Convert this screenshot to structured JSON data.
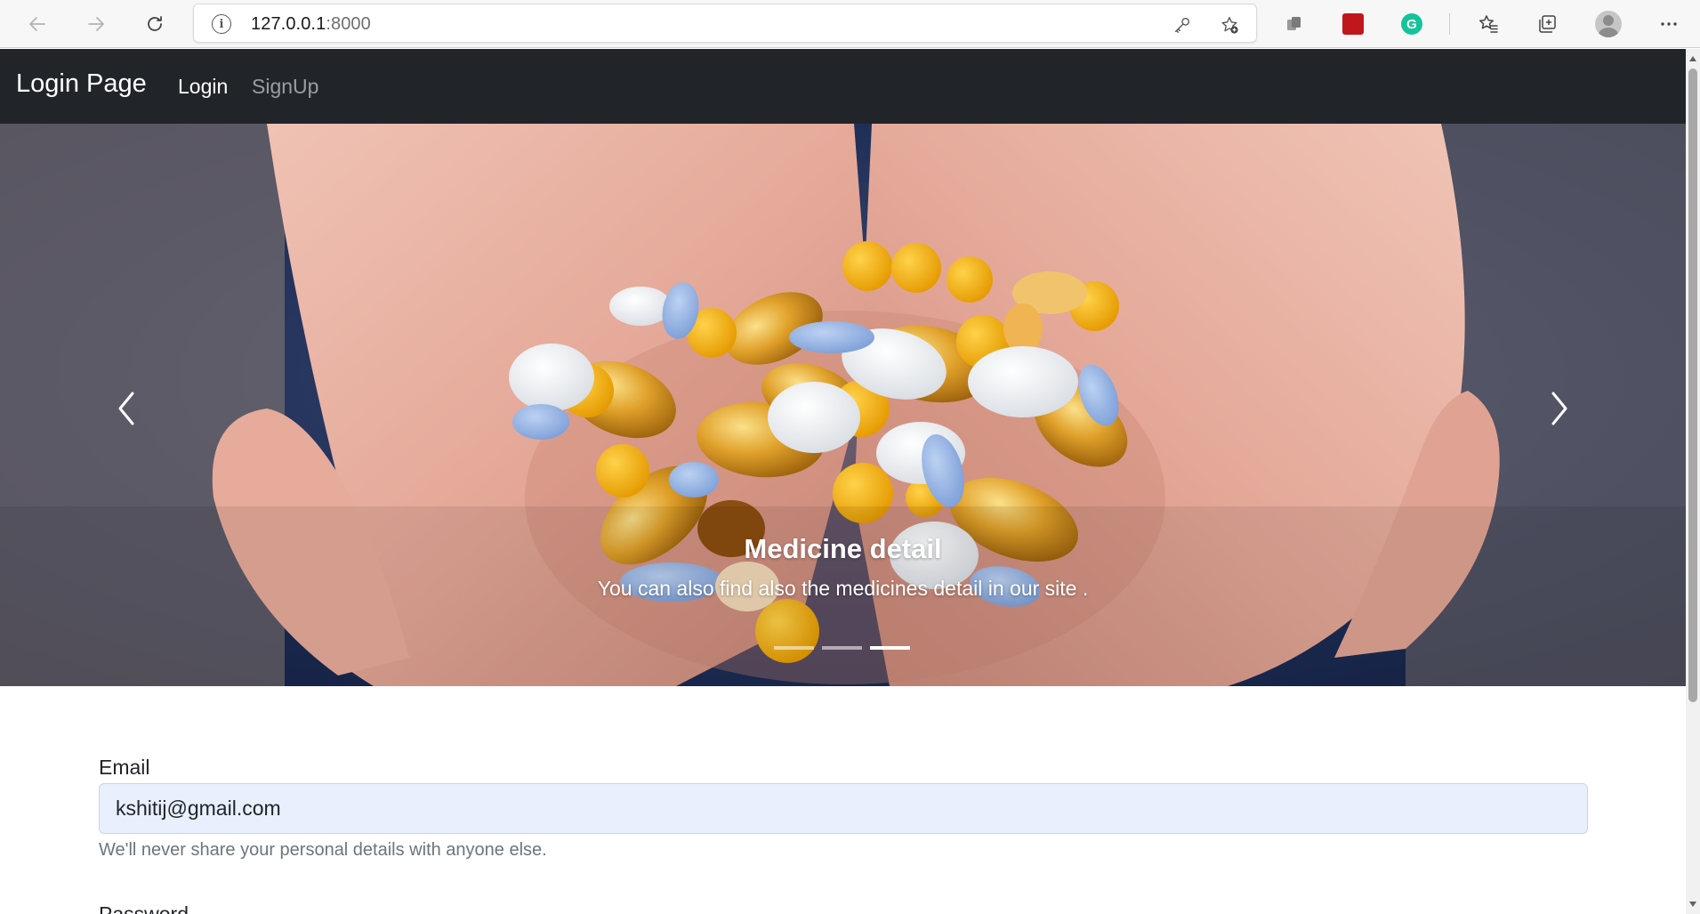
{
  "browser": {
    "url_host": "127.0.0.1",
    "url_port": ":8000",
    "icons": {
      "back": "arrow-left-icon",
      "forward": "arrow-right-icon",
      "reload": "reload-icon",
      "site_info": "info-icon",
      "key": "key-icon",
      "favorite_add": "star-plus-icon",
      "extension": "extension-icon",
      "pdf": "pdf-icon",
      "grammarly": "grammarly-icon",
      "favorites": "favorites-icon",
      "collections": "collections-icon",
      "profile": "avatar",
      "menu": "more-icon"
    },
    "site_info_glyph": "i",
    "grammarly_glyph": "G"
  },
  "navbar": {
    "brand": "Login Page",
    "links": [
      {
        "label": "Login",
        "active": true
      },
      {
        "label": "SignUp",
        "active": false
      }
    ]
  },
  "carousel": {
    "caption_title": "Medicine detail",
    "caption_text": "You can also find also the medicines detail in our site .",
    "slides": 3,
    "active_slide": 3
  },
  "form": {
    "email_label": "Email",
    "email_value": "kshitij@gmail.com",
    "email_help": "We'll never share your personal details with anyone else.",
    "password_label": "Password"
  },
  "colors": {
    "navbar_bg": "#212529",
    "input_autofill_bg": "#e8f0fe",
    "help_text": "#6c757d"
  }
}
